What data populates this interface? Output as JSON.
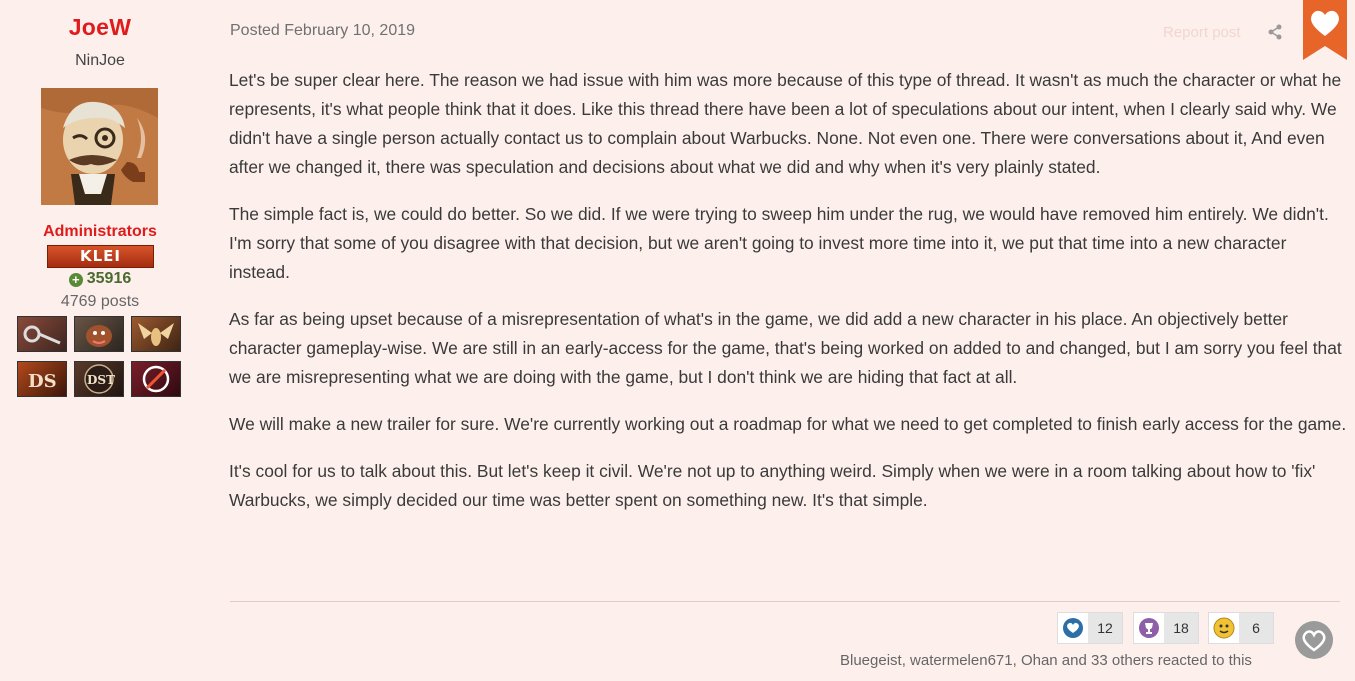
{
  "author": {
    "name": "JoeW",
    "title": "NinJoe",
    "group": "Administrators",
    "group_badge": "KLEI",
    "reputation": "35916",
    "posts": "4769 posts",
    "badges": [
      "key-badge",
      "creature-badge",
      "glommer-badge",
      "ds-badge",
      "dst-badge",
      "no-dlc-badge"
    ]
  },
  "post": {
    "posted": "Posted February 10, 2019",
    "report": "Report post",
    "paragraphs": [
      "Let's be super clear here. The reason we had issue with him was more because of this type of thread. It wasn't as much the character or what he represents, it's what people think that it does. Like this thread there have been a lot of speculations about our intent, when I clearly said why. We didn't have a single person actually contact us to complain about Warbucks. None. Not even one. There were conversations about it, And even after we changed it, there was speculation and decisions about what we did and why when it's very plainly stated.",
      "The simple fact is, we could do better. So we did. If we were trying to sweep him under the rug, we would have removed him entirely. We didn't. I'm sorry that some of you disagree with that decision, but we aren't going to invest more time into it, we put that time into a new character instead.",
      "As far as being upset because of a misrepresentation of what's in the game, we did add a new character in his place. An objectively better character gameplay-wise. We are still in an early-access for the game, that's being worked on added to and changed, but I am sorry you feel that we are misrepresenting what we are doing with the game, but I don't think we are hiding that fact at all.",
      "We will make a new trailer for sure. We're currently working out a roadmap for what we need to get completed to finish early access for the game.",
      "It's cool for us to talk about this. But let's keep it civil. We're not up to anything weird. Simply when we were in a room talking about how to 'fix' Warbucks, we simply decided our time was better spent on something new. It's that simple."
    ]
  },
  "reactions": {
    "items": [
      {
        "icon": "heart-icon",
        "count": "12"
      },
      {
        "icon": "trophy-icon",
        "count": "18"
      },
      {
        "icon": "smile-icon",
        "count": "6"
      }
    ],
    "summary": "Bluegeist, watermelen671, Ohan and 33 others reacted to this"
  },
  "colors": {
    "background": "#fdf0ec",
    "author_name": "#e01b1b",
    "accent_orange": "#e8652a"
  }
}
